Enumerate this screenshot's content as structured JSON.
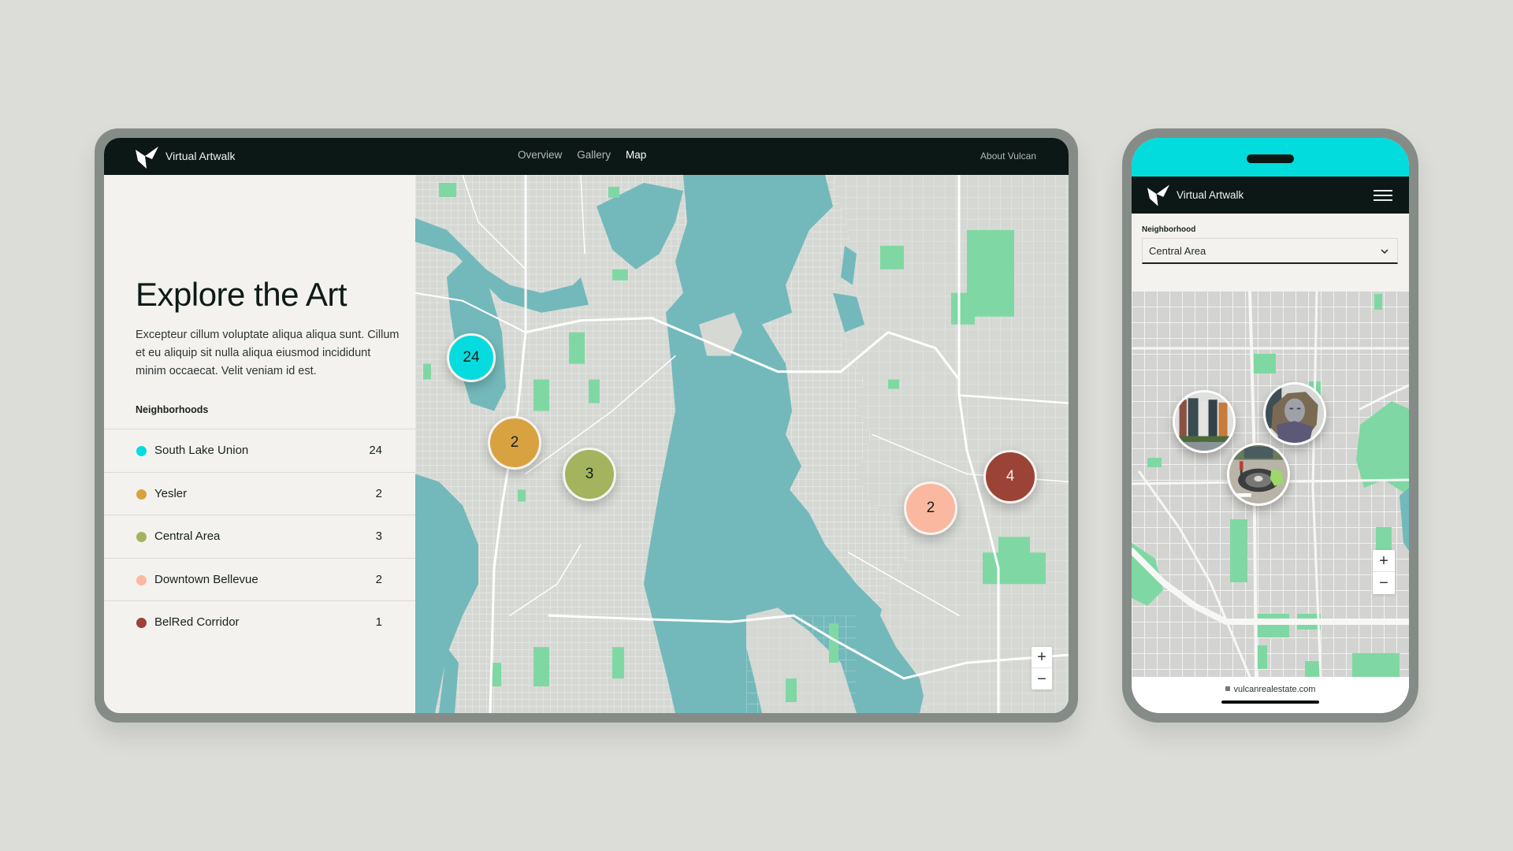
{
  "tablet": {
    "brand": "Virtual Artwalk",
    "nav": [
      {
        "label": "Overview",
        "active": false
      },
      {
        "label": "Gallery",
        "active": false
      },
      {
        "label": "Map",
        "active": true
      }
    ],
    "about_link": "About Vulcan",
    "heading": "Explore the Art",
    "description": "Excepteur cillum voluptate aliqua aliqua sunt. Cillum et eu aliquip sit nulla aliqua eiusmod incididunt minim occaecat. Velit veniam id est.",
    "neighborhoods_label": "Neighborhoods",
    "neighborhoods": [
      {
        "name": "South Lake Union",
        "count": "24",
        "color": "#06dcdf"
      },
      {
        "name": "Yesler",
        "count": "2",
        "color": "#d9a241"
      },
      {
        "name": "Central Area",
        "count": "3",
        "color": "#a3b35e"
      },
      {
        "name": "Downtown Bellevue",
        "count": "2",
        "color": "#fbb8a0"
      },
      {
        "name": "BelRed Corridor",
        "count": "1",
        "color": "#9b4337"
      }
    ],
    "map_markers": [
      {
        "neighborhood": "South Lake Union",
        "label": "24",
        "color": "#06dcdf",
        "text_color": "#14201e"
      },
      {
        "neighborhood": "Yesler",
        "label": "2",
        "color": "#d9a241",
        "text_color": "#14201e"
      },
      {
        "neighborhood": "Central Area",
        "label": "3",
        "color": "#a3b35e",
        "text_color": "#14201e"
      },
      {
        "neighborhood": "Downtown Bellevue",
        "label": "2",
        "color": "#fbb8a0",
        "text_color": "#14201e"
      },
      {
        "neighborhood": "BelRed Corridor",
        "label": "4",
        "color": "#9b4337",
        "text_color": "#f5ece8"
      }
    ],
    "zoom_in": "+",
    "zoom_out": "−"
  },
  "phone": {
    "brand": "Virtual Artwalk",
    "neighborhood_label": "Neighborhood",
    "neighborhood_selected": "Central Area",
    "photo_markers": [
      {
        "subject": "building-facade-artwork"
      },
      {
        "subject": "sculpture-face"
      },
      {
        "subject": "ground-mosaic-artwork"
      }
    ],
    "zoom_in": "+",
    "zoom_out": "−",
    "url": "vulcanrealestate.com"
  },
  "colors": {
    "nav_bg": "#0b1816",
    "accent_cyan": "#02dcdc",
    "water": "#73b9bb",
    "land": "#d6d8d4",
    "park": "#7fd8a3"
  }
}
